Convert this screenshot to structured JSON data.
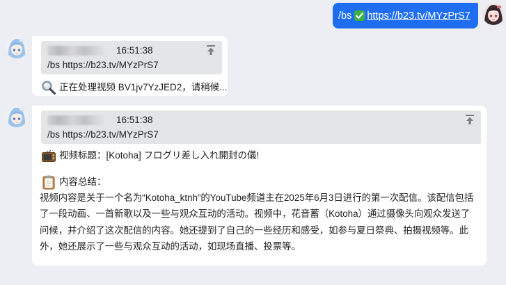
{
  "outgoing": {
    "prefix": "/bs",
    "link": "https://b23.tv/MYzPrS7",
    "check_icon": "check-mark-button-icon"
  },
  "messages": [
    {
      "reply": {
        "time": "16:51:38",
        "text": "/bs https://b23.tv/MYzPrS7"
      },
      "status_icon": "magnifier-icon",
      "status": "正在处理视频 BV1jv7YzJED2，请稍候..."
    },
    {
      "reply": {
        "time": "16:51:38",
        "text": "/bs https://b23.tv/MYzPrS7"
      },
      "title_icon": "television-icon",
      "title_line": "视频标题：[Kotoha] フログリ差し入れ開封の儀!",
      "summary_icon": "clipboard-icon",
      "summary_label": "内容总结：",
      "summary_text": "视频内容是关于一个名为“Kotoha_ktnh”的YouTube频道主在2025年6月3日进行的第一次配信。该配信包括了一段动画、一首新歌以及一些与观众互动的活动。视频中，花音蓄（Kotoha）通过摄像头向观众发送了问候，并介绍了这次配信的内容。她还提到了自己的一些经历和感受，如参与夏日祭典、拍摄视频等。此外，她还展示了一些与观众互动的活动，如现场直播、投票等。"
    }
  ]
}
